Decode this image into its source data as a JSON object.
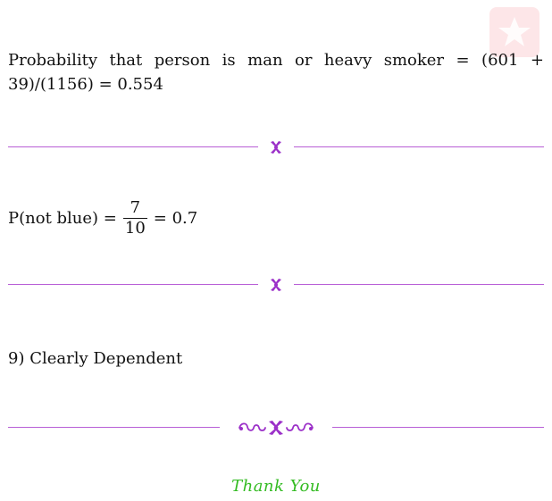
{
  "answers": {
    "q7": "Probability that person is man or heavy smoker = (601 + 39)/(1156) = 0.554",
    "q8": {
      "prefix": "P(not blue) =",
      "numerator": "7",
      "denominator": "10",
      "suffix": "= 0.7"
    },
    "q9": "9) Clearly Dependent"
  },
  "closing": "Thank You",
  "icons": {
    "watermark": "star-logo-icon",
    "divider": "fleuron-icon",
    "final_divider": "flourish-ornament-icon"
  },
  "colors": {
    "divider": "#b85fd6",
    "ornament": "#9b30c8",
    "closing": "#33bb22",
    "watermark_bg": "#fde6e8",
    "watermark_fg": "#ffffff"
  }
}
